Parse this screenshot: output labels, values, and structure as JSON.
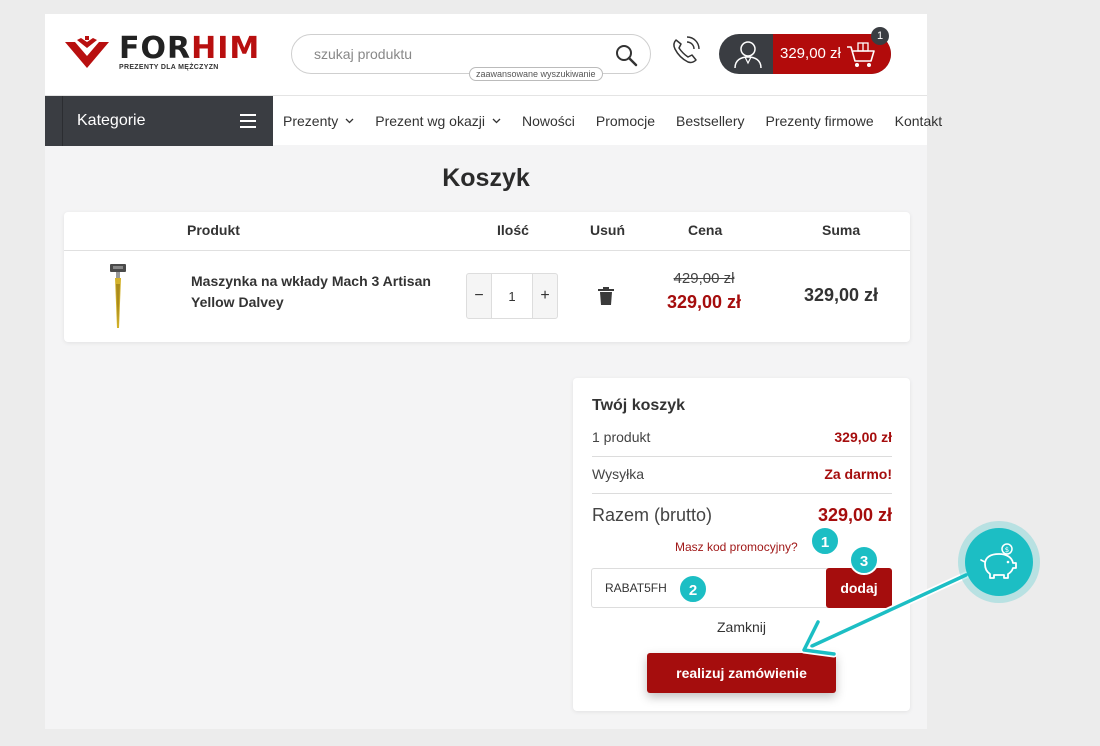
{
  "header": {
    "logo_text_dark": "FOR",
    "logo_text_red": "HIM",
    "logo_subtitle": "PREZENTY DLA MĘŻCZYZN",
    "search_placeholder": "szukaj produktu",
    "advanced_search": "zaawansowane wyszukiwanie",
    "cart_total": "329,00 zł",
    "cart_count": "1"
  },
  "nav": {
    "categories_label": "Kategorie",
    "items": [
      {
        "label": "Prezenty",
        "has_dropdown": true
      },
      {
        "label": "Prezent wg okazji",
        "has_dropdown": true
      },
      {
        "label": "Nowości"
      },
      {
        "label": "Promocje"
      },
      {
        "label": "Bestsellery"
      },
      {
        "label": "Prezenty firmowe"
      },
      {
        "label": "Kontakt"
      }
    ]
  },
  "page_title": "Koszyk",
  "cart_table": {
    "headers": {
      "product": "Produkt",
      "quantity": "Ilość",
      "remove": "Usuń",
      "price": "Cena",
      "sum": "Suma"
    },
    "items": [
      {
        "name": "Maszynka na wkłady Mach 3 Artisan Yellow Dalvey",
        "quantity": "1",
        "qty_minus": "−",
        "qty_plus": "+",
        "price_old": "429,00 zł",
        "price_new": "329,00 zł",
        "sum": "329,00 zł"
      }
    ]
  },
  "summary": {
    "title": "Twój koszyk",
    "products_label": "1 produkt",
    "products_value": "329,00 zł",
    "shipping_label": "Wysyłka",
    "shipping_value": "Za darmo!",
    "total_label": "Razem (brutto)",
    "total_value": "329,00 zł",
    "promo_link": "Masz kod promocyjny?",
    "promo_code_value": "RABAT5FH",
    "promo_button": "dodaj",
    "close_link": "Zamknij",
    "order_button": "realizuj zamówienie"
  },
  "annotations": {
    "steps": [
      "1",
      "2",
      "3"
    ],
    "accent_color": "#1cbec4"
  },
  "colors": {
    "brand_red": "#b20b0b",
    "dark": "#3a3d42"
  }
}
